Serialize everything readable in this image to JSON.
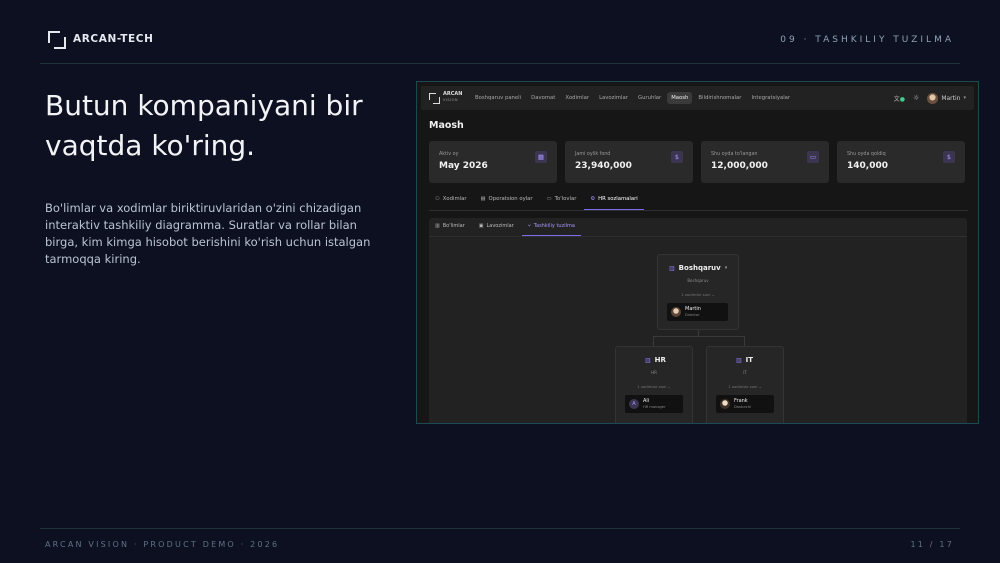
{
  "slide": {
    "brand": "ARCAN-TECH",
    "section": "09 · TASHKILIY TUZILMA",
    "headline_line1": "Butun kompaniyani bir",
    "headline_line2": "vaqtda ko'ring.",
    "description": "Bo'limlar va xodimlar biriktiruvlaridan o'zini chizadigan interaktiv tashkiliy diagramma. Suratlar va rollar bilan birga, kim kimga hisobot berishini ko'rish uchun istalgan tarmoqqa kiring.",
    "footer_left": "ARCAN VISION · PRODUCT DEMO · 2026",
    "footer_right": "11 / 17"
  },
  "app": {
    "logo_name": "ARCAN",
    "logo_sub": "VISION",
    "nav": [
      "Boshqaruv paneli",
      "Davomat",
      "Xodimlar",
      "Lavozimlar",
      "Guruhlar",
      "Maosh",
      "Bildirishnomalar",
      "Integratsiyalar"
    ],
    "active_nav": "Maosh",
    "user_name": "Martin",
    "page_title": "Maosh",
    "cards": [
      {
        "label": "Aktiv oy",
        "value": "May 2026",
        "icon": "calendar-icon"
      },
      {
        "label": "Jami oylik fond",
        "value": "23,940,000",
        "icon": "dollar-icon"
      },
      {
        "label": "Shu oyda to'langan",
        "value": "12,000,000",
        "icon": "wallet-icon"
      },
      {
        "label": "Shu oyda qoldiq",
        "value": "140,000",
        "icon": "dollar-icon"
      }
    ],
    "subtabs": [
      "Xodimlar",
      "Operatsion oylar",
      "To'lovlar",
      "HR sozlamalari"
    ],
    "active_subtab": "HR sozlamalari",
    "inner_tabs": [
      "Bo'limlar",
      "Lavozimlar",
      "Tashkiliy tuzilma"
    ],
    "active_inner_tab": "Tashkiliy tuzilma",
    "org": {
      "root": {
        "title": "Boshqaruv",
        "sub": "Boshqaruv",
        "count": "1 xodimlar soni",
        "emp_name": "Martin",
        "emp_role": "Director"
      },
      "children": [
        {
          "title": "HR",
          "sub": "HR",
          "count": "1 xodimlar soni",
          "emp_name": "Ali",
          "emp_role": "HR manager",
          "emp_initial": "A"
        },
        {
          "title": "IT",
          "sub": "IT",
          "count": "1 xodimlar soni",
          "emp_name": "Frank",
          "emp_role": "Dasturchi"
        }
      ]
    }
  },
  "colors": {
    "background": "#0d1020",
    "accent": "#7c6cf0",
    "divider": "#1d3338"
  }
}
